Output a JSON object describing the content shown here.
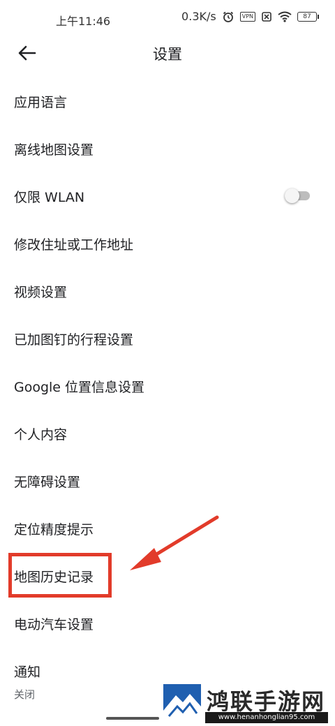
{
  "status_bar": {
    "time": "上午11:46",
    "network_speed": "0.3K/s",
    "vpn": "VPN",
    "battery": "87",
    "icons": [
      "alarm-icon",
      "vpn-icon",
      "no-sim-icon",
      "wifi-icon",
      "battery-icon"
    ]
  },
  "header": {
    "title": "设置",
    "back_icon": "arrow-left-icon"
  },
  "settings": {
    "items": [
      {
        "label": "应用语言"
      },
      {
        "label": "离线地图设置"
      },
      {
        "label": "仅限 WLAN",
        "toggle": false
      },
      {
        "label": "修改住址或工作地址"
      },
      {
        "label": "视频设置"
      },
      {
        "label": "已加图钉的行程设置"
      },
      {
        "label": "Google 位置信息设置"
      },
      {
        "label": "个人内容"
      },
      {
        "label": "无障碍设置"
      },
      {
        "label": "定位精度提示"
      },
      {
        "label": "地图历史记录"
      },
      {
        "label": "电动汽车设置"
      },
      {
        "label": "通知",
        "sublabel": "关闭"
      }
    ]
  },
  "annotation": {
    "highlight_color": "#e23b2a",
    "highlighted_item": "地图历史记录"
  },
  "watermark": {
    "title": "鸿联手游网",
    "url": "www.henanhonglian95.com"
  },
  "colors": {
    "text": "#202124",
    "secondary_text": "#5f6368",
    "toggle_off_track": "#bdbdbd",
    "annotation_red": "#e23b2a"
  }
}
